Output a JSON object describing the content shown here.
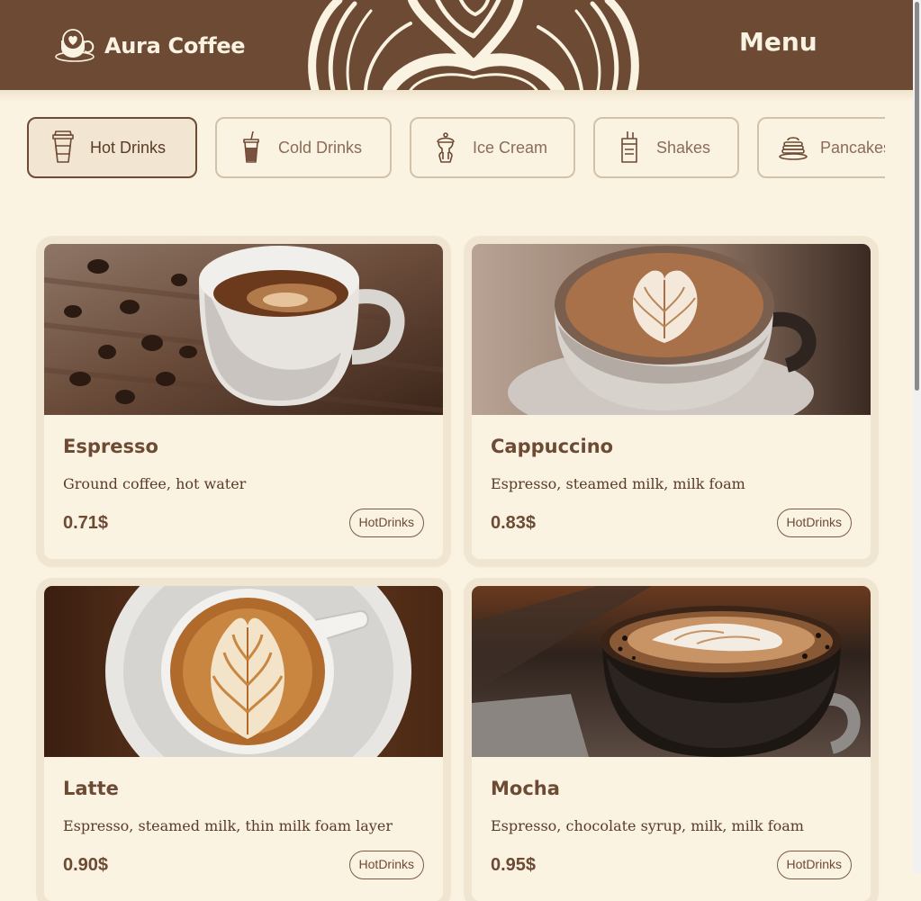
{
  "header": {
    "brand": "Aura Coffee",
    "title": "Menu"
  },
  "categories": [
    {
      "label": "Hot Drinks",
      "icon": "hot-cup-icon",
      "active": true
    },
    {
      "label": "Cold Drinks",
      "icon": "iced-cup-icon",
      "active": false
    },
    {
      "label": "Ice Cream",
      "icon": "ice-cream-icon",
      "active": false
    },
    {
      "label": "Shakes",
      "icon": "shake-icon",
      "active": false
    },
    {
      "label": "Pancakes",
      "icon": "pancake-icon",
      "active": false
    }
  ],
  "products": [
    {
      "name": "Espresso",
      "description": "Ground coffee, hot water",
      "price": "0.71$",
      "tag": "HotDrinks"
    },
    {
      "name": "Cappuccino",
      "description": "Espresso, steamed milk, milk foam",
      "price": "0.83$",
      "tag": "HotDrinks"
    },
    {
      "name": "Latte",
      "description": "Espresso, steamed milk, thin milk foam layer",
      "price": "0.90$",
      "tag": "HotDrinks"
    },
    {
      "name": "Mocha",
      "description": "Espresso, chocolate syrup, milk, milk foam",
      "price": "0.95$",
      "tag": "HotDrinks"
    }
  ],
  "colors": {
    "brand_brown": "#6d4a34",
    "cream_background": "#fbf3e2",
    "active_tab": "#f2e6d2"
  }
}
